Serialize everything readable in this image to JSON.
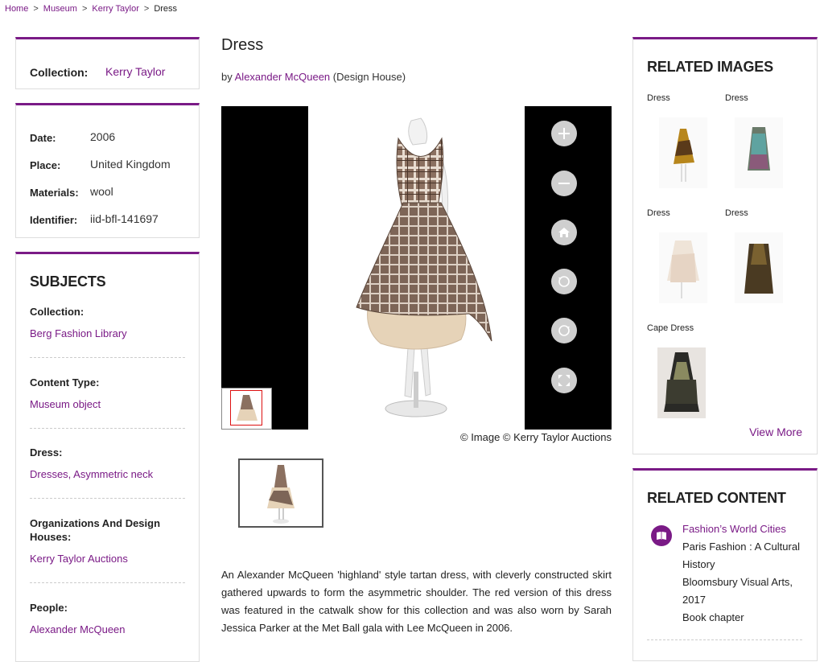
{
  "breadcrumb": [
    {
      "label": "Home",
      "link": true
    },
    {
      "label": "Museum",
      "link": true
    },
    {
      "label": "Kerry Taylor",
      "link": true
    },
    {
      "label": "Dress",
      "link": false
    }
  ],
  "breadcrumb_sep": ">",
  "collection": {
    "label": "Collection:",
    "value": "Kerry Taylor"
  },
  "details": [
    {
      "label": "Date:",
      "value": "2006"
    },
    {
      "label": "Place:",
      "value": "United Kingdom"
    },
    {
      "label": "Materials:",
      "value": "wool"
    },
    {
      "label": "Identifier:",
      "value": "iid-bfl-141697"
    }
  ],
  "subjects": {
    "heading": "SUBJECTS",
    "groups": [
      {
        "label": "Collection:",
        "link": "Berg Fashion Library"
      },
      {
        "label": "Content Type:",
        "link": "Museum object"
      },
      {
        "label": "Dress:",
        "link": "Dresses, Asymmetric neck"
      },
      {
        "label": "Organizations And Design Houses:",
        "link": "Kerry Taylor Auctions"
      },
      {
        "label": "People:",
        "link": "Alexander McQueen"
      }
    ]
  },
  "main": {
    "title": "Dress",
    "by_prefix": "by",
    "designer": "Alexander McQueen",
    "designer_role": "(Design House)",
    "credit": "© Image © Kerry Taylor Auctions",
    "description": "An Alexander McQueen 'highland' style tartan dress, with cleverly constructed skirt gathered upwards to form the asymmetric shoulder. The red version of this dress was featured in the catwalk show for this collection and was also worn by Sarah Jessica Parker at the Met Ball gala with Lee McQueen in 2006."
  },
  "viewer_controls": [
    {
      "name": "zoom-in-icon"
    },
    {
      "name": "zoom-out-icon"
    },
    {
      "name": "home-icon"
    },
    {
      "name": "rotate-left-icon"
    },
    {
      "name": "rotate-right-icon"
    },
    {
      "name": "fullscreen-icon"
    }
  ],
  "related_images": {
    "heading": "RELATED IMAGES",
    "items": [
      {
        "caption": "Dress"
      },
      {
        "caption": "Dress"
      },
      {
        "caption": "Dress"
      },
      {
        "caption": "Dress"
      },
      {
        "caption": "Cape Dress"
      }
    ],
    "view_more": "View More"
  },
  "related_content": {
    "heading": "RELATED CONTENT",
    "item": {
      "title": "Fashion’s World Cities",
      "subtitle": "Paris Fashion : A Cultural History",
      "publisher": "Bloomsbury Visual Arts, 2017",
      "type": "Book chapter"
    }
  },
  "colors": {
    "accent": "#7a1a86",
    "viewer_bg": "#000000"
  }
}
